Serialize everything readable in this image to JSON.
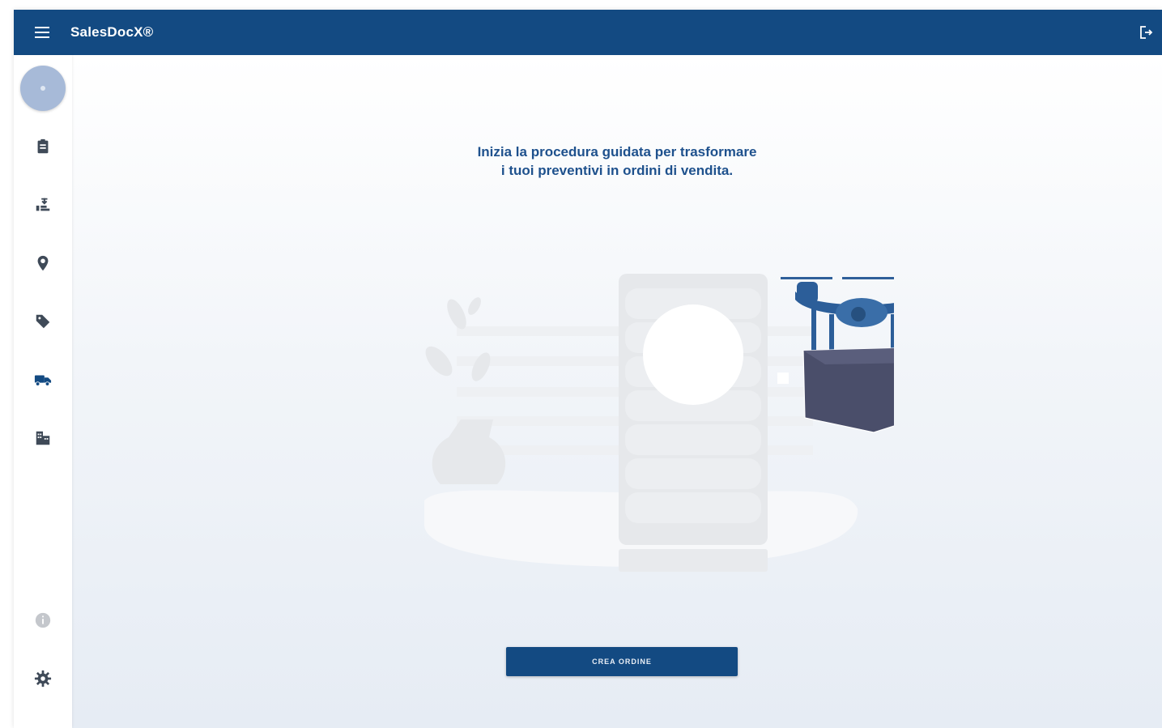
{
  "app": {
    "title": "SalesDocX®"
  },
  "topbar": {
    "menu_icon": "hamburger-icon",
    "logout_icon": "logout-icon"
  },
  "sidebar": {
    "items": [
      {
        "icon": "avatar-icon"
      },
      {
        "icon": "clipboard-icon"
      },
      {
        "icon": "order-flow-icon"
      },
      {
        "icon": "location-pin-icon"
      },
      {
        "icon": "tag-icon"
      },
      {
        "icon": "truck-icon",
        "active": true
      },
      {
        "icon": "building-icon"
      },
      {
        "icon": "info-icon"
      },
      {
        "icon": "gear-icon"
      }
    ]
  },
  "main": {
    "headline_line1": "Inizia la procedura guidata per trasformare",
    "headline_line2": "i tuoi preventivi in ordini di vendita.",
    "cta_label": "CREA ORDINE"
  },
  "colors": {
    "primary": "#134a82",
    "heading": "#1e518d",
    "icon": "#3f4a58",
    "active_icon": "#134a82",
    "avatar": "#a7bad8"
  }
}
